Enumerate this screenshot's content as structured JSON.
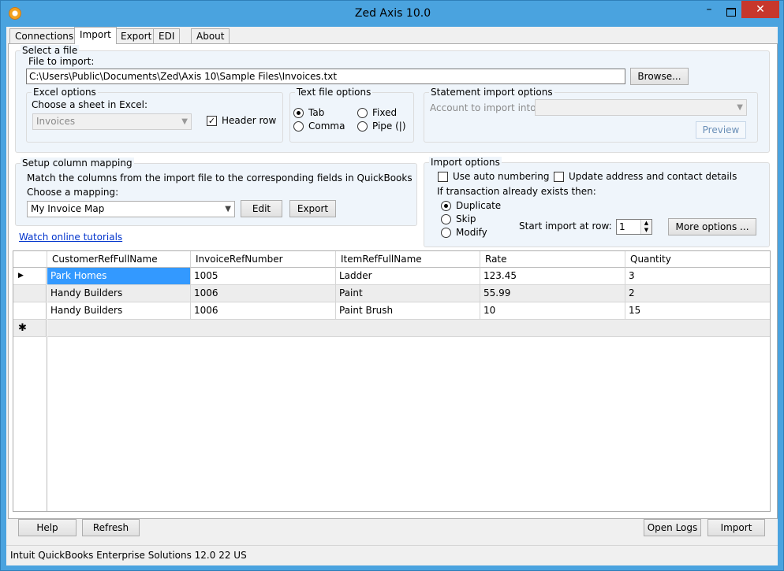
{
  "window": {
    "title": "Zed Axis 10.0",
    "minimize": "–",
    "close": "✕"
  },
  "tabs": [
    "Connections",
    "Import",
    "Export",
    "EDI",
    "About"
  ],
  "select_file": {
    "group_title": "Select a file",
    "file_label": "File to import:",
    "file_value": "C:\\Users\\Public\\Documents\\Zed\\Axis 10\\Sample Files\\Invoices.txt",
    "browse": "Browse..."
  },
  "excel": {
    "title": "Excel options",
    "sheet_label": "Choose a sheet in Excel:",
    "sheet_value": "Invoices",
    "header_row": "Header row",
    "header_row_checked": true
  },
  "text_file": {
    "title": "Text file options",
    "tab": "Tab",
    "comma": "Comma",
    "fixed": "Fixed",
    "pipe": "Pipe (|)",
    "selected": "Tab"
  },
  "statement": {
    "title": "Statement import options",
    "account_label": "Account to import into",
    "account_value": "",
    "preview": "Preview"
  },
  "mapping": {
    "title": "Setup column mapping",
    "instructions": "Match the columns from the import file to the corresponding fields in QuickBooks",
    "choose_label": "Choose a mapping:",
    "map_value": "My Invoice Map",
    "edit": "Edit",
    "export": "Export"
  },
  "tutorials_link": "Watch online tutorials",
  "import_options": {
    "title": "Import options",
    "auto_numbering": "Use auto numbering",
    "update_address": "Update address and contact details",
    "exists_label": "If transaction already exists then:",
    "duplicate": "Duplicate",
    "skip": "Skip",
    "modify": "Modify",
    "selected": "Duplicate",
    "start_row_label": "Start import at row:",
    "start_row_value": "1",
    "more_options": "More options ..."
  },
  "grid": {
    "columns": [
      "CustomerRefFullName",
      "InvoiceRefNumber",
      "ItemRefFullName",
      "Rate",
      "Quantity"
    ],
    "rows": [
      [
        "Park Homes",
        "1005",
        "Ladder",
        "123.45",
        "3"
      ],
      [
        "Handy Builders",
        "1006",
        "Paint",
        "55.99",
        "2"
      ],
      [
        "Handy Builders",
        "1006",
        "Paint Brush",
        "10",
        "15"
      ]
    ],
    "current_row_marker": "▶",
    "new_row_marker": "✱"
  },
  "bottom": {
    "help": "Help",
    "refresh": "Refresh",
    "open_logs": "Open Logs",
    "import": "Import"
  },
  "status": {
    "text": "Intuit QuickBooks Enterprise Solutions 12.0  22  US"
  },
  "colors": {
    "window_frame": "#4aa3df",
    "close_button": "#c7372c",
    "selection": "#3399ff",
    "group_bg": "#eff5fb"
  }
}
